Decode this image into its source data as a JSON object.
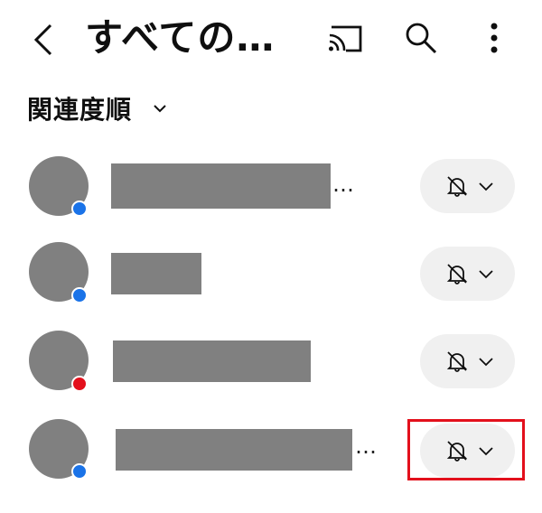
{
  "header": {
    "title": "すべての…",
    "back_icon": "chevron-left-icon",
    "cast_icon": "cast-icon",
    "search_icon": "search-icon",
    "more_icon": "more-vert-icon"
  },
  "sort": {
    "label": "関連度順",
    "icon": "chevron-down-icon"
  },
  "channels": [
    {
      "status_dot": "#1a73e8",
      "name_truncated": true,
      "notification_icon": "bell-off-icon"
    },
    {
      "status_dot": "#1a73e8",
      "name_truncated": false,
      "notification_icon": "bell-off-icon"
    },
    {
      "status_dot": "#e3101c",
      "name_truncated": false,
      "notification_icon": "bell-off-icon"
    },
    {
      "status_dot": "#1a73e8",
      "name_truncated": true,
      "notification_icon": "bell-off-icon",
      "highlighted": true
    }
  ],
  "ellipsis_text": "…",
  "colors": {
    "highlight": "#e3101c",
    "redacted": "#808080",
    "pill": "#f0f0f0"
  }
}
